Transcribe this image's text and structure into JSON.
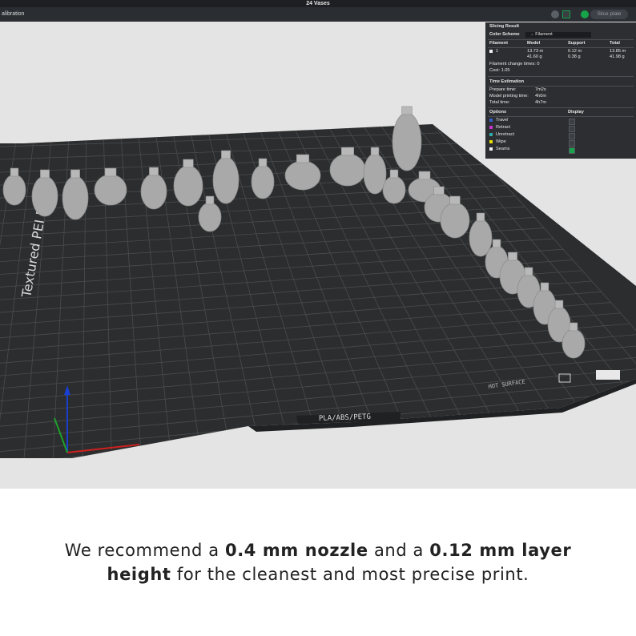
{
  "window": {
    "title": "24 Vases"
  },
  "toolbar": {
    "tab_label": "alibration",
    "slice_button": "Slice plate"
  },
  "plate": {
    "name": "Textured PEI Plate",
    "filament_label": "PLA/ABS/PETG",
    "surface_label": "HOT SURFACE"
  },
  "slicing": {
    "title": "Slicing Result",
    "color_scheme_label": "Color Scheme",
    "color_scheme_value": "Filament",
    "columns": [
      "Filament",
      "Model",
      "Support",
      "Total"
    ],
    "row": {
      "id": "1",
      "model_len": "13.73 m",
      "model_wt": "41.60 g",
      "support_len": "0.12 m",
      "support_wt": "0.38 g",
      "total_len": "13.85 m",
      "total_wt": "41.98 g"
    },
    "change_times": "Filament change times:  0",
    "cost": "Cost:  1.05"
  },
  "time": {
    "title": "Time Estimation",
    "rows": [
      {
        "label": "Prepare time:",
        "value": "7m2s"
      },
      {
        "label": "Model printing time:",
        "value": "4h0m"
      },
      {
        "label": "Total time:",
        "value": "4h7m"
      }
    ]
  },
  "options": {
    "header": "Options",
    "display_header": "Display",
    "items": [
      {
        "label": "Travel",
        "color": "#3a5fcd",
        "checked": false
      },
      {
        "label": "Retract",
        "color": "#cc33cc",
        "checked": false
      },
      {
        "label": "Unretract",
        "color": "#33aaaa",
        "checked": false
      },
      {
        "label": "Wipe",
        "color": "#e8e000",
        "checked": false
      },
      {
        "label": "Seams",
        "color": "#f0f0f0",
        "checked": true
      }
    ]
  },
  "caption": {
    "p1": "We recommend a ",
    "b1": "0.4 mm nozzle",
    "p2": " and a ",
    "b2": "0.12 mm layer",
    "b3": "height",
    "p3": " for the cleanest and most precise print."
  },
  "colors": {
    "plate": "#2b2d2e",
    "grid": "#4b4e50",
    "model": "#a9a9a9",
    "viewport": "#e4e4e4"
  }
}
